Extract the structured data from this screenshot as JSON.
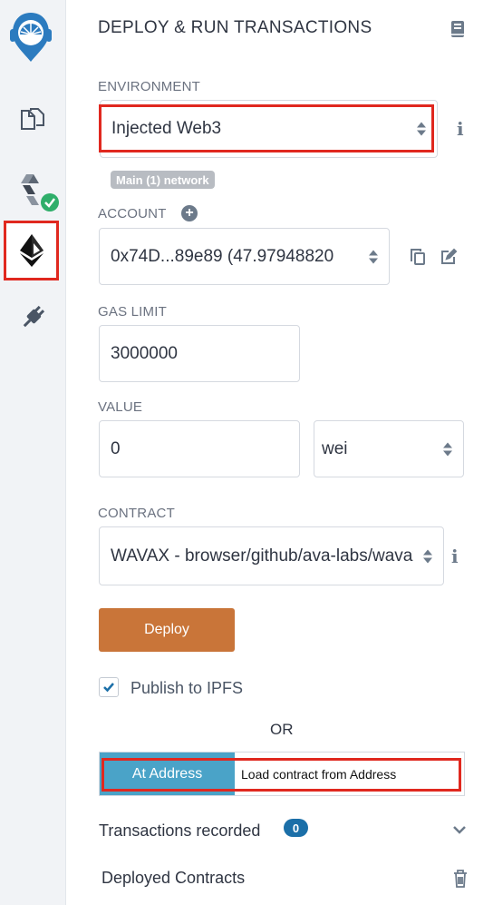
{
  "sidebar": {
    "items": [
      {
        "name": "remix-logo-icon"
      },
      {
        "name": "file-explorer-icon"
      },
      {
        "name": "solidity-compiler-icon"
      },
      {
        "name": "deploy-run-icon"
      },
      {
        "name": "plugin-manager-icon"
      }
    ]
  },
  "header": {
    "title": "DEPLOY & RUN TRANSACTIONS"
  },
  "environment": {
    "label": "ENVIRONMENT",
    "value": "Injected Web3",
    "network_badge": "Main (1) network"
  },
  "account": {
    "label": "ACCOUNT",
    "value": "0x74D...89e89 (47.97948820"
  },
  "gas_limit": {
    "label": "GAS LIMIT",
    "value": "3000000"
  },
  "value": {
    "label": "VALUE",
    "amount": "0",
    "unit": "wei"
  },
  "contract": {
    "label": "CONTRACT",
    "value": "WAVAX - browser/github/ava-labs/wavax"
  },
  "deploy": {
    "label": "Deploy"
  },
  "publish": {
    "label": "Publish to IPFS",
    "checked": true
  },
  "or_text": "OR",
  "at_address": {
    "button_label": "At Address",
    "placeholder": "Load contract from Address"
  },
  "transactions": {
    "label": "Transactions recorded",
    "count": "0"
  },
  "deployed": {
    "label": "Deployed Contracts"
  },
  "colors": {
    "accent": "#1f77b4",
    "deploy_button": "#c97539",
    "at_address_button": "#4aa3c8",
    "highlight_red": "#e0281f",
    "badge_gray": "#b8bcc2",
    "count_badge": "#1b6fa8"
  }
}
